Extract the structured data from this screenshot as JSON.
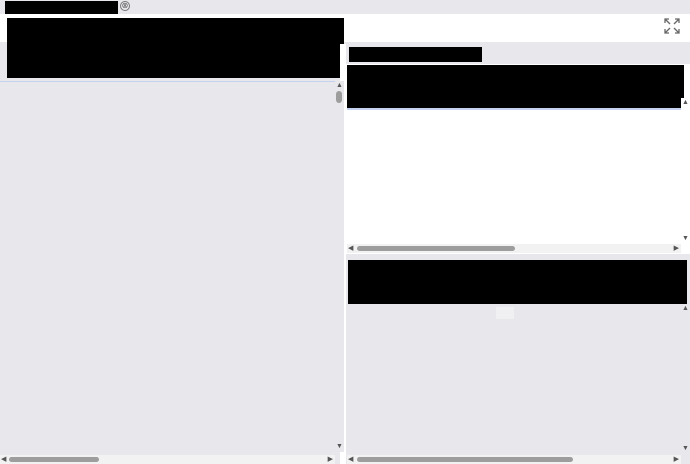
{
  "tabs": [
    {
      "label": "",
      "redacted": true
    }
  ],
  "tab_close_glyph": "⊗",
  "toolbar": {
    "expand_icon": "expand-icon"
  },
  "panels": {
    "left": {
      "title": "",
      "redacted": true
    },
    "right_top": {
      "tab": "",
      "header": "",
      "redacted": true
    },
    "right_bottom": {
      "header": "",
      "redacted": true
    }
  },
  "colors": {
    "background": "#e8e7ec",
    "panel": "#ffffff",
    "scrollbar_thumb": "#9d9d9d",
    "focus_line": "#c4d2ef"
  },
  "scroll_arrows": {
    "up": "▲",
    "down": "▼",
    "left": "◀",
    "right": "▶"
  }
}
